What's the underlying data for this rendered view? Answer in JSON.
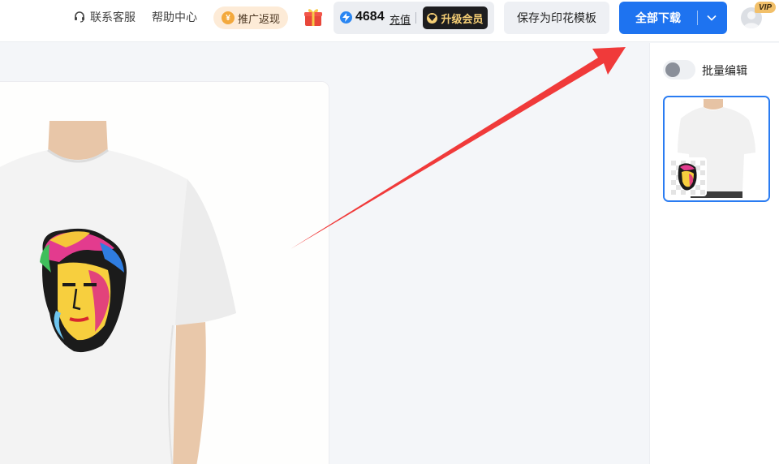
{
  "header": {
    "support_label": "联系客服",
    "help_label": "帮助中心",
    "promo_label": "推广返现",
    "credits_value": "4684",
    "recharge_label": "充值",
    "upgrade_label": "升级会员",
    "save_template_label": "保存为印花模板",
    "download_all_label": "全部下载",
    "vip_badge": "VIP"
  },
  "right_panel": {
    "batch_edit_label": "批量编辑",
    "batch_edit_enabled": false
  },
  "colors": {
    "primary": "#1e73f0",
    "upgrade_bg": "#1d1d1f",
    "upgrade_text": "#f6cf75",
    "promo_bg": "#fdebd7",
    "annotation_arrow": "#f03a3a"
  },
  "icons": {
    "support": "headset-icon",
    "promo": "coin-icon",
    "gift": "gift-icon",
    "credits": "lightning-icon",
    "upgrade": "diamond-icon",
    "download_menu": "chevron-down-icon",
    "avatar": "user-avatar-icon"
  }
}
